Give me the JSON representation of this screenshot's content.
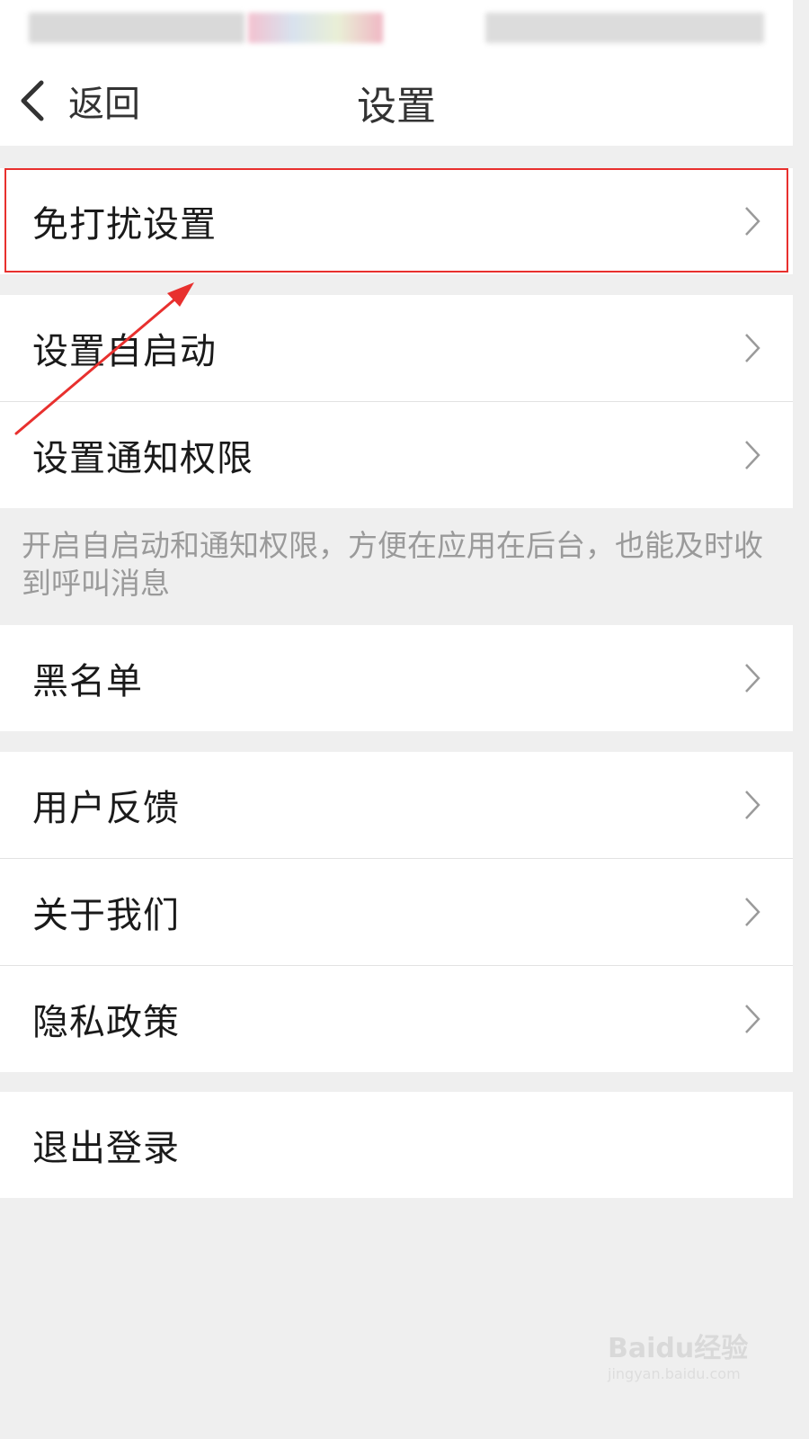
{
  "nav": {
    "back_label": "返回",
    "title": "设置"
  },
  "rows": [
    {
      "label": "免打扰设置",
      "has_chevron": true
    },
    {
      "label": "设置自启动",
      "has_chevron": true
    },
    {
      "label": "设置通知权限",
      "has_chevron": true
    },
    {
      "label": "黑名单",
      "has_chevron": true
    },
    {
      "label": "用户反馈",
      "has_chevron": true
    },
    {
      "label": "关于我们",
      "has_chevron": true
    },
    {
      "label": "隐私政策",
      "has_chevron": true
    },
    {
      "label": "退出登录",
      "has_chevron": false
    }
  ],
  "hint": "开启自启动和通知权限，方便在应用在后台，也能及时收到呼叫消息",
  "watermark": {
    "logo": "Baidu经验",
    "sub": "jingyan.baidu.com"
  },
  "colors": {
    "background": "#efefef",
    "row": "#ffffff",
    "annotation": "#e8302e",
    "hint_text": "#9a9a9a"
  }
}
